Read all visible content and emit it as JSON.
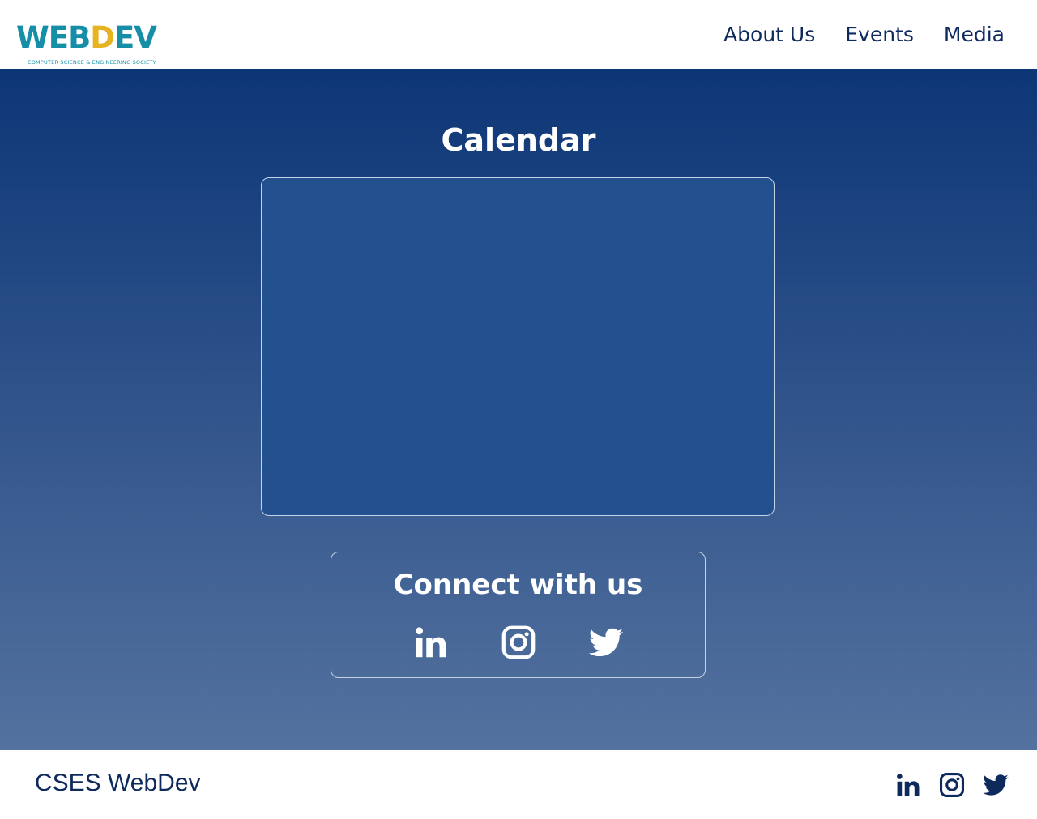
{
  "header": {
    "logo": {
      "word_part1": "WEB",
      "word_accent_d": "D",
      "word_part2": "E",
      "word_accent_v": "V",
      "tagline": "COMPUTER SCIENCE & ENGINEERING SOCIETY",
      "colors": {
        "primary": "#178ea8",
        "accent": "#e6b422"
      }
    },
    "nav": [
      {
        "label": "About Us"
      },
      {
        "label": "Events"
      },
      {
        "label": "Media"
      }
    ]
  },
  "main": {
    "calendar_title": "Calendar",
    "connect_title": "Connect with us",
    "connect_icons": [
      "linkedin-icon",
      "instagram-icon",
      "twitter-icon"
    ],
    "colors": {
      "gradient_top": "#0d3677",
      "gradient_bottom": "#54729f",
      "calendar_fill": "#23508e"
    }
  },
  "footer": {
    "brand": "CSES WebDev",
    "icons": [
      "linkedin-icon",
      "instagram-icon",
      "twitter-icon"
    ],
    "colors": {
      "text": "#0e2a5c"
    }
  }
}
